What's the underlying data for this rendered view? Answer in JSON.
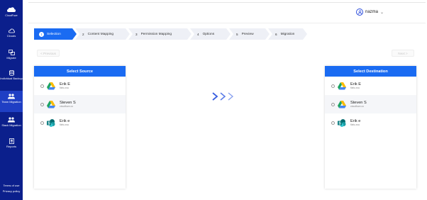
{
  "sidebar": {
    "brand_label": "CloudFuze",
    "items": [
      {
        "label": "Clouds",
        "icon": "cloud-icon",
        "active": false
      },
      {
        "label": "Migrate",
        "icon": "migrate-icon",
        "active": false
      },
      {
        "label": "Individual Backup",
        "icon": "database-icon",
        "active": false
      },
      {
        "label": "Team Migration",
        "icon": "team-icon",
        "active": true
      },
      {
        "label": "Slack Migration",
        "icon": "slack-icon",
        "active": false
      },
      {
        "label": "Reports",
        "icon": "reports-icon",
        "active": false
      }
    ],
    "footer": {
      "terms": "Terms of use",
      "privacy": "Privacy policy"
    }
  },
  "header": {
    "username": "nazma",
    "user_icon": "user-icon"
  },
  "stepper": [
    {
      "num": "1",
      "label": "Selection",
      "active": true
    },
    {
      "num": "2",
      "label": "Content Mapping",
      "active": false
    },
    {
      "num": "3",
      "label": "Permission Mapping",
      "active": false
    },
    {
      "num": "4",
      "label": "Options",
      "active": false
    },
    {
      "num": "5",
      "label": "Preview",
      "active": false
    },
    {
      "num": "6",
      "label": "Migration",
      "active": false
    }
  ],
  "buttons": {
    "previous": "< Previous",
    "next": "Next >"
  },
  "source": {
    "title": "Select Source",
    "rows": [
      {
        "name": "Erik E",
        "email": "filelu.ecc",
        "cloud": "google-drive-icon"
      },
      {
        "name": "Steven S",
        "email": "cloudfuze.co",
        "cloud": "google-drive-icon"
      },
      {
        "name": "Erik e",
        "email": "filelu.ecc",
        "cloud": "sharepoint-icon"
      }
    ]
  },
  "destination": {
    "title": "Select Destination",
    "rows": [
      {
        "name": "Erik E",
        "email": "filelu.ecc",
        "cloud": "google-drive-icon"
      },
      {
        "name": "Steven S",
        "email": "cloudfuze.co",
        "cloud": "google-drive-icon"
      },
      {
        "name": "Erik e",
        "email": "filelu.ecc",
        "cloud": "sharepoint-icon"
      }
    ]
  },
  "colors": {
    "sidebar": "#0b1f8c",
    "accent": "#1a6bf2",
    "arrows": "#3a5fe0"
  }
}
